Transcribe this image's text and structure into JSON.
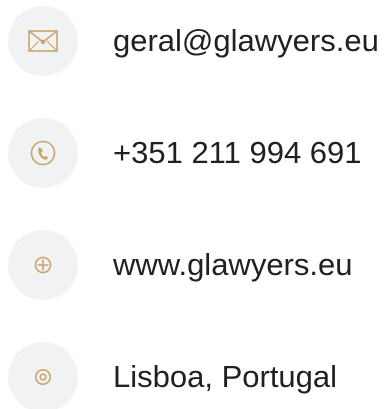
{
  "contacts": [
    {
      "icon": "envelope-icon",
      "text": "geral@glawyers.eu"
    },
    {
      "icon": "phone-icon",
      "text": "+351 211 994 691"
    },
    {
      "icon": "globe-icon",
      "text": "www.glawyers.eu"
    },
    {
      "icon": "location-icon",
      "text": "Lisboa, Portugal"
    }
  ],
  "colors": {
    "accent": "#c9a56b",
    "icon_bg": "#f1f2f4",
    "text": "#1f1f24"
  }
}
